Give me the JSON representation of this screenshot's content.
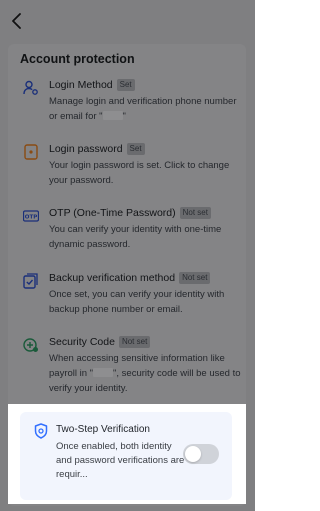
{
  "section_title": "Account protection",
  "items": [
    {
      "title": "Login Method",
      "tag": "Set",
      "desc_a": "Manage login and verification phone number or email for \"",
      "desc_b": "\""
    },
    {
      "title": "Login password",
      "tag": "Set",
      "desc": "Your login password is set. Click to change your password."
    },
    {
      "title": "OTP (One-Time Password)",
      "tag": "Not set",
      "desc": "You can verify your identity with one-time dynamic password."
    },
    {
      "title": "Backup verification method",
      "tag": "Not set",
      "desc": "Once set, you can verify your identity with backup phone number or email."
    },
    {
      "title": "Security Code",
      "tag": "Not set",
      "desc_a": "When accessing sensitive information like payroll in \"",
      "desc_b": "\", security code will be used to verify your identity."
    }
  ],
  "two_step": {
    "title": "Two-Step Verification",
    "desc": "Once enabled, both identity and password verifications are requir...",
    "enabled": false
  },
  "colors": {
    "accent": "#3370ff",
    "overlay": "#7f7f81",
    "toggle_off": "#d0d3d9"
  }
}
